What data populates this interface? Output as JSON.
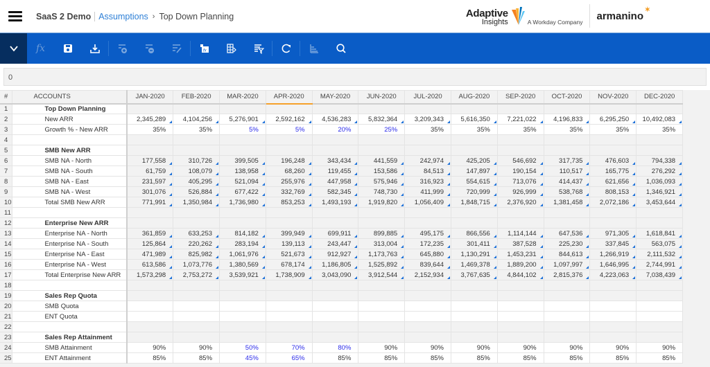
{
  "header": {
    "app_name": "SaaS 2 Demo",
    "breadcrumb_link": "Assumptions",
    "breadcrumb_separator": "›",
    "breadcrumb_current": "Top Down Planning",
    "brand_adaptive_line1": "Adaptive",
    "brand_adaptive_line2": "Insights",
    "brand_tagline": "A Workday Company",
    "brand_partner": "armanino"
  },
  "toolbar": {
    "accent_color": "#0a5cc6",
    "items": [
      {
        "name": "collapse",
        "icon": "chevron-down-icon"
      },
      {
        "name": "formula",
        "icon": "fx-icon",
        "label": "fx"
      },
      {
        "name": "save",
        "icon": "save-icon"
      },
      {
        "name": "export",
        "icon": "download-icon"
      },
      {
        "name": "insert-row",
        "icon": "insert-row-icon"
      },
      {
        "name": "delete-row",
        "icon": "delete-row-icon"
      },
      {
        "name": "edit-notes",
        "icon": "edit-list-icon"
      },
      {
        "name": "cell-formula",
        "icon": "cell-fx-icon"
      },
      {
        "name": "sheet-options",
        "icon": "grid-options-icon"
      },
      {
        "name": "filter",
        "icon": "filter-icon"
      },
      {
        "name": "refresh",
        "icon": "refresh-icon"
      },
      {
        "name": "chart",
        "icon": "bar-chart-icon"
      },
      {
        "name": "search",
        "icon": "search-icon"
      }
    ]
  },
  "formula_bar": {
    "value": "0"
  },
  "grid": {
    "headers": {
      "num": "#",
      "accounts": "ACCOUNTS",
      "months": [
        "JAN-2020",
        "FEB-2020",
        "MAR-2020",
        "APR-2020",
        "MAY-2020",
        "JUN-2020",
        "JUL-2020",
        "AUG-2020",
        "SEP-2020",
        "OCT-2020",
        "NOV-2020",
        "DEC-2020"
      ],
      "active_month_index": 3
    },
    "rows": [
      {
        "n": "1",
        "label": "Top Down Planning",
        "bold": true,
        "values": []
      },
      {
        "n": "2",
        "label": "New ARR",
        "white": true,
        "tri": true,
        "values": [
          "2,345,289",
          "4,104,256",
          "5,276,901",
          "2,592,162",
          "4,536,283",
          "5,832,364",
          "3,209,343",
          "5,616,350",
          "7,221,022",
          "4,196,833",
          "6,295,250",
          "10,492,083"
        ]
      },
      {
        "n": "3",
        "label": "Growth % - New ARR",
        "white": true,
        "blue": [
          2,
          3,
          4,
          5
        ],
        "values": [
          "35%",
          "35%",
          "5%",
          "5%",
          "20%",
          "25%",
          "35%",
          "35%",
          "35%",
          "35%",
          "35%",
          "35%"
        ]
      },
      {
        "n": "4",
        "label": "",
        "values": []
      },
      {
        "n": "5",
        "label": "SMB New ARR",
        "bold": true,
        "values": []
      },
      {
        "n": "6",
        "label": "SMB NA - North",
        "tri": true,
        "values": [
          "177,558",
          "310,726",
          "399,505",
          "196,248",
          "343,434",
          "441,559",
          "242,974",
          "425,205",
          "546,692",
          "317,735",
          "476,603",
          "794,338"
        ]
      },
      {
        "n": "7",
        "label": "SMB NA - South",
        "tri": true,
        "values": [
          "61,759",
          "108,079",
          "138,958",
          "68,260",
          "119,455",
          "153,586",
          "84,513",
          "147,897",
          "190,154",
          "110,517",
          "165,775",
          "276,292"
        ]
      },
      {
        "n": "8",
        "label": "SMB NA - East",
        "tri": true,
        "values": [
          "231,597",
          "405,295",
          "521,094",
          "255,976",
          "447,958",
          "575,946",
          "316,923",
          "554,615",
          "713,076",
          "414,437",
          "621,656",
          "1,036,093"
        ]
      },
      {
        "n": "9",
        "label": "SMB NA - West",
        "tri": true,
        "values": [
          "301,076",
          "526,884",
          "677,422",
          "332,769",
          "582,345",
          "748,730",
          "411,999",
          "720,999",
          "926,999",
          "538,768",
          "808,153",
          "1,346,921"
        ]
      },
      {
        "n": "10",
        "label": "Total SMB New ARR",
        "tri": true,
        "values": [
          "771,991",
          "1,350,984",
          "1,736,980",
          "853,253",
          "1,493,193",
          "1,919,820",
          "1,056,409",
          "1,848,715",
          "2,376,920",
          "1,381,458",
          "2,072,186",
          "3,453,644"
        ]
      },
      {
        "n": "11",
        "label": "",
        "values": []
      },
      {
        "n": "12",
        "label": "Enterprise New ARR",
        "bold": true,
        "values": []
      },
      {
        "n": "13",
        "label": "Enterprise NA - North",
        "tri": true,
        "values": [
          "361,859",
          "633,253",
          "814,182",
          "399,949",
          "699,911",
          "899,885",
          "495,175",
          "866,556",
          "1,114,144",
          "647,536",
          "971,305",
          "1,618,841"
        ]
      },
      {
        "n": "14",
        "label": "Enterprise NA - South",
        "tri": true,
        "values": [
          "125,864",
          "220,262",
          "283,194",
          "139,113",
          "243,447",
          "313,004",
          "172,235",
          "301,411",
          "387,528",
          "225,230",
          "337,845",
          "563,075"
        ]
      },
      {
        "n": "15",
        "label": "Enterprise NA - East",
        "tri": true,
        "values": [
          "471,989",
          "825,982",
          "1,061,976",
          "521,673",
          "912,927",
          "1,173,763",
          "645,880",
          "1,130,291",
          "1,453,231",
          "844,613",
          "1,266,919",
          "2,111,532"
        ]
      },
      {
        "n": "16",
        "label": "Enterprise NA - West",
        "tri": true,
        "values": [
          "613,586",
          "1,073,776",
          "1,380,569",
          "678,174",
          "1,186,805",
          "1,525,892",
          "839,644",
          "1,469,378",
          "1,889,200",
          "1,097,997",
          "1,646,995",
          "2,744,991"
        ]
      },
      {
        "n": "17",
        "label": "Total Enterprise New ARR",
        "tri": true,
        "values": [
          "1,573,298",
          "2,753,272",
          "3,539,921",
          "1,738,909",
          "3,043,090",
          "3,912,544",
          "2,152,934",
          "3,767,635",
          "4,844,102",
          "2,815,376",
          "4,223,063",
          "7,038,439"
        ]
      },
      {
        "n": "18",
        "label": "",
        "values": []
      },
      {
        "n": "19",
        "label": "Sales Rep Quota",
        "bold": true,
        "values": []
      },
      {
        "n": "20",
        "label": "SMB Quota",
        "white": true,
        "values": [
          "",
          "",
          "",
          "",
          "",
          "",
          "",
          "",
          "",
          "",
          "",
          ""
        ]
      },
      {
        "n": "21",
        "label": "ENT Quota",
        "white": true,
        "values": [
          "",
          "",
          "",
          "",
          "",
          "",
          "",
          "",
          "",
          "",
          "",
          ""
        ]
      },
      {
        "n": "22",
        "label": "",
        "values": []
      },
      {
        "n": "23",
        "label": "Sales Rep Attainment",
        "bold": true,
        "values": []
      },
      {
        "n": "24",
        "label": "SMB Attainment",
        "white": true,
        "blue": [
          2,
          3,
          4
        ],
        "values": [
          "90%",
          "90%",
          "50%",
          "70%",
          "80%",
          "90%",
          "90%",
          "90%",
          "90%",
          "90%",
          "90%",
          "90%"
        ]
      },
      {
        "n": "25",
        "label": "ENT Attainment",
        "white": true,
        "blue": [
          2,
          3
        ],
        "values": [
          "85%",
          "85%",
          "45%",
          "65%",
          "85%",
          "85%",
          "85%",
          "85%",
          "85%",
          "85%",
          "85%",
          "85%"
        ]
      }
    ]
  }
}
